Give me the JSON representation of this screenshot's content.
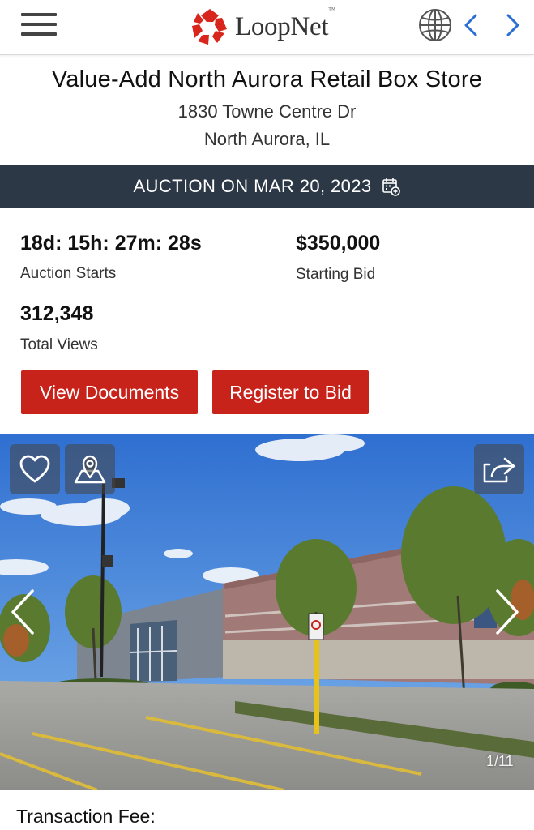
{
  "header": {
    "logo_text": "LoopNet",
    "logo_tm": "™",
    "icons": [
      "menu-icon",
      "loopnet-logo-icon",
      "globe-icon",
      "chevron-left-icon",
      "chevron-right-icon"
    ]
  },
  "listing": {
    "title": "Value-Add North Aurora Retail Box Store",
    "address_line1": "1830 Towne Centre Dr",
    "address_line2": "North Aurora, IL"
  },
  "auction_bar": {
    "text": "AUCTION ON MAR 20, 2023",
    "icon": "calendar-add-icon"
  },
  "stats": {
    "countdown": "18d: 15h: 27m: 28s",
    "countdown_label": "Auction Starts",
    "starting_bid": "$350,000",
    "starting_bid_label": "Starting Bid",
    "total_views": "312,348",
    "total_views_label": "Total Views"
  },
  "actions": {
    "view_documents": "View Documents",
    "register_to_bid": "Register to Bid"
  },
  "photo": {
    "counter": "1/11",
    "icons": [
      "heart-icon",
      "map-pin-icon",
      "share-icon",
      "arrow-left-icon",
      "arrow-right-icon"
    ]
  },
  "section": {
    "transaction_fee_label": "Transaction Fee:"
  },
  "colors": {
    "accent_red": "#c8231b",
    "auction_bar": "#2c3846",
    "nav_blue": "#2a6fd6"
  }
}
